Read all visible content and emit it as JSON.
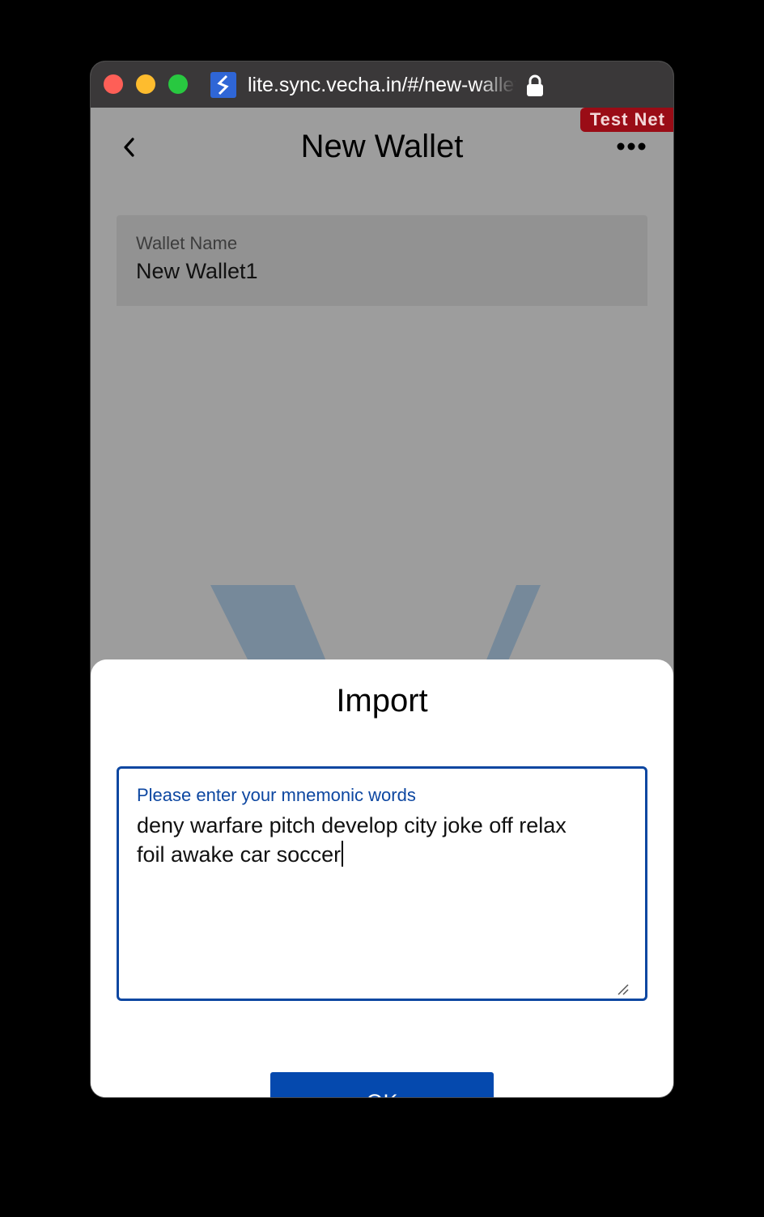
{
  "browser": {
    "url": "lite.sync.vecha.in/#/new-wallet",
    "site_icon": "sync-logo-icon",
    "lock_icon": "lock-icon"
  },
  "app": {
    "network_badge": "Test Net",
    "title": "New Wallet",
    "back_icon": "chevron-left-icon",
    "more_icon": "more-horizontal-icon",
    "wallet_name": {
      "label": "Wallet Name",
      "value": "New Wallet1"
    }
  },
  "dialog": {
    "title": "Import",
    "mnemonic": {
      "label": "Please enter your mnemonic words",
      "value": "deny warfare pitch develop city joke off relax\nfoil awake car soccer"
    },
    "ok_label": "OK"
  },
  "colors": {
    "accent": "#0549ae",
    "badge": "#9a0c16",
    "overlay_bg": "#9d9d9d"
  }
}
